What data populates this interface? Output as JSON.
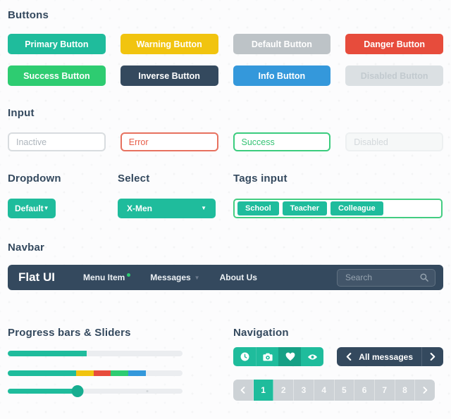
{
  "colors": {
    "turquoise": "#1FBC9C",
    "green_sea": "#16A085",
    "emerald": "#2ECC71",
    "sunflower": "#F1C40F",
    "alizarin": "#E74C3C",
    "peter_river": "#3498DB",
    "wet_asphalt": "#34495E",
    "silver": "#BDC3C7"
  },
  "buttons": {
    "title": "Buttons",
    "items": [
      {
        "label": "Primary Button"
      },
      {
        "label": "Warning Button"
      },
      {
        "label": "Default Button"
      },
      {
        "label": "Danger Button"
      },
      {
        "label": "Success Button"
      },
      {
        "label": "Inverse Button"
      },
      {
        "label": "Info Button"
      },
      {
        "label": "Disabled Button"
      }
    ]
  },
  "inputs": {
    "title": "Input",
    "fields": [
      {
        "state": "inactive",
        "placeholder": "Inactive"
      },
      {
        "state": "error",
        "value": "Error"
      },
      {
        "state": "success",
        "value": "Success"
      },
      {
        "state": "disabled",
        "placeholder": "Disabled"
      }
    ]
  },
  "dropdown": {
    "title": "Dropdown",
    "label": "Default"
  },
  "select": {
    "title": "Select",
    "value": "X-Men"
  },
  "tags": {
    "title": "Tags input",
    "items": [
      "School",
      "Teacher",
      "Colleague"
    ]
  },
  "navbar": {
    "title": "Navbar",
    "brand": "Flat UI",
    "menu": [
      "Menu Item",
      "Messages",
      "About Us"
    ],
    "search_placeholder": "Search"
  },
  "progress": {
    "title": "Progress bars & Sliders",
    "bar1_percent": 45,
    "bar2_segments": [
      {
        "color": "#1FBC9C",
        "percent": 39
      },
      {
        "color": "#F1C40F",
        "percent": 10
      },
      {
        "color": "#E74C3C",
        "percent": 10
      },
      {
        "color": "#2ECC71",
        "percent": 10
      },
      {
        "color": "#3498DB",
        "percent": 10
      }
    ],
    "slider_percent": 40,
    "slider_tick_percent": 80
  },
  "navigation": {
    "title": "Navigation",
    "icons": [
      "clock",
      "camera",
      "heart",
      "eye"
    ],
    "active_icon": "heart",
    "messages_button": "All messages",
    "pages": [
      "1",
      "2",
      "3",
      "4",
      "5",
      "6",
      "7",
      "8"
    ],
    "active_page": "1"
  }
}
